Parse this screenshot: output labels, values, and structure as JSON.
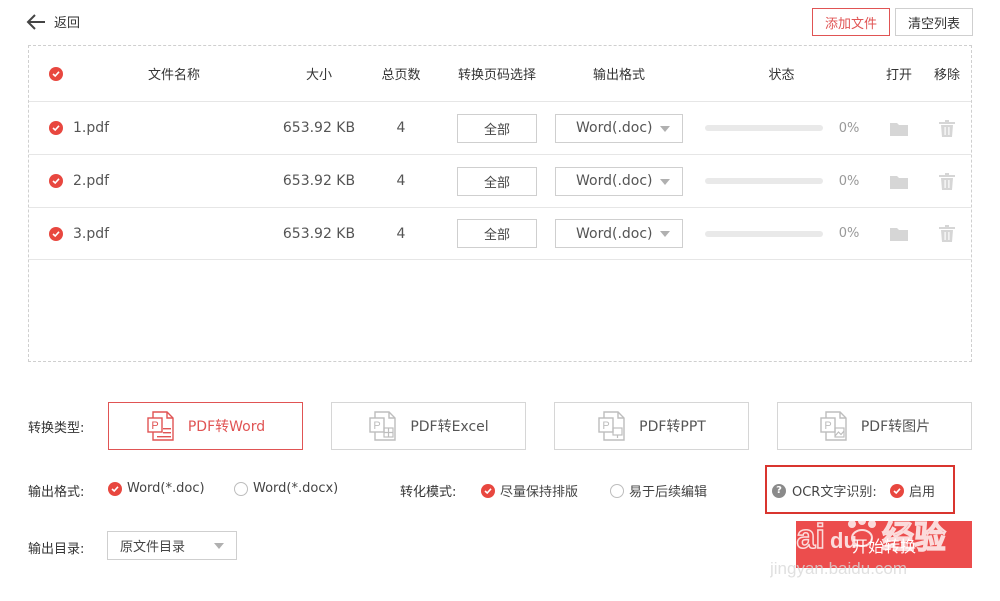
{
  "nav": {
    "back_label": "返回"
  },
  "toolbar": {
    "add_file_label": "添加文件",
    "clear_list_label": "清空列表"
  },
  "table": {
    "headers": {
      "name": "文件名称",
      "size": "大小",
      "pages": "总页数",
      "page_select": "转换页码选择",
      "format": "输出格式",
      "status": "状态",
      "open": "打开",
      "remove": "移除"
    },
    "rows": [
      {
        "name": "1.pdf",
        "size": "653.92 KB",
        "pages": "4",
        "page_select": "全部",
        "format": "Word(.doc)",
        "progress_percent": 0,
        "progress_label": "0%"
      },
      {
        "name": "2.pdf",
        "size": "653.92 KB",
        "pages": "4",
        "page_select": "全部",
        "format": "Word(.doc)",
        "progress_percent": 0,
        "progress_label": "0%"
      },
      {
        "name": "3.pdf",
        "size": "653.92 KB",
        "pages": "4",
        "page_select": "全部",
        "format": "Word(.doc)",
        "progress_percent": 0,
        "progress_label": "0%"
      }
    ]
  },
  "conversion": {
    "type_label": "转换类型:",
    "types": [
      "PDF转Word",
      "PDF转Excel",
      "PDF转PPT",
      "PDF转图片"
    ],
    "active_type": "PDF转Word"
  },
  "output_format": {
    "label": "输出格式:",
    "options": [
      "Word(*.doc)",
      "Word(*.docx)"
    ],
    "selected": "Word(*.doc)"
  },
  "mode": {
    "label": "转化模式:",
    "options": [
      "尽量保持排版",
      "易于后续编辑"
    ],
    "selected": "尽量保持排版"
  },
  "ocr": {
    "label": "OCR文字识别:",
    "enable_label": "启用",
    "enabled": true,
    "help_glyph": "?"
  },
  "output_dir": {
    "label": "输出目录:",
    "value": "原文件目录"
  },
  "start": {
    "label": "开始转换"
  },
  "watermark": {
    "text_top": "Bai",
    "text_logo": "du",
    "text_cn": "经验",
    "text_url": "jingyan.baidu.com"
  },
  "colors": {
    "accent": "#e8473f",
    "border": "#cfcfcf",
    "ocr_highlight": "#d9352f"
  }
}
